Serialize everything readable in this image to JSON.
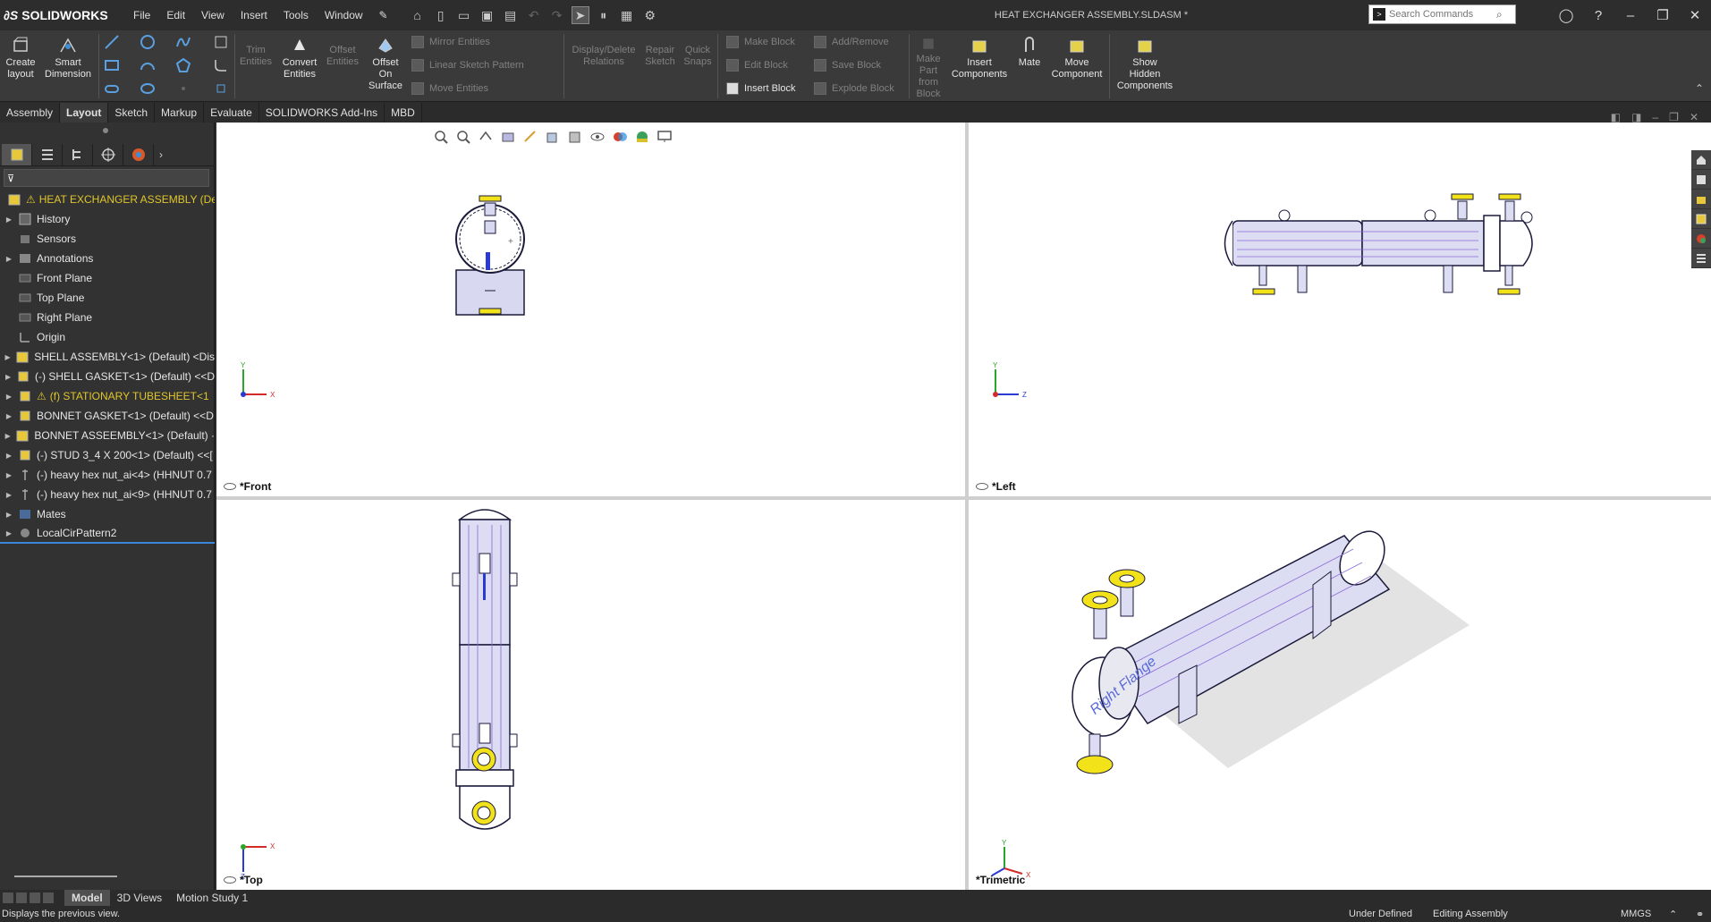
{
  "app": {
    "name": "SOLIDWORKS",
    "brand_color": "#da1f26"
  },
  "menu": [
    "File",
    "Edit",
    "View",
    "Insert",
    "Tools",
    "Window"
  ],
  "document_title": "HEAT EXCHANGER ASSEMBLY.SLDASM *",
  "search": {
    "placeholder": "Search Commands"
  },
  "ribbon": {
    "create_layout": "Create\nlayout",
    "smart_dimension": "Smart\nDimension",
    "trim_entities": "Trim\nEntities",
    "convert_entities": "Convert\nEntities",
    "offset_entities": "Offset\nEntities",
    "offset_on_surface": "Offset\nOn\nSurface",
    "mirror_entities": "Mirror Entities",
    "linear_sketch_pattern": "Linear Sketch Pattern",
    "move_entities": "Move Entities",
    "display_delete_relations": "Display/Delete\nRelations",
    "repair_sketch": "Repair\nSketch",
    "quick_snaps": "Quick\nSnaps",
    "make_block": "Make Block",
    "edit_block": "Edit Block",
    "insert_block": "Insert Block",
    "add_remove": "Add/Remove",
    "save_block": "Save Block",
    "explode_block": "Explode Block",
    "make_part_from_block": "Make\nPart\nfrom\nBlock",
    "insert_components": "Insert\nComponents",
    "mate": "Mate",
    "move_component": "Move\nComponent",
    "show_hidden_components": "Show\nHidden\nComponents"
  },
  "command_tabs": [
    "Assembly",
    "Layout",
    "Sketch",
    "Markup",
    "Evaluate",
    "SOLIDWORKS Add-Ins",
    "MBD"
  ],
  "active_tab": "Layout",
  "tree": [
    {
      "label": "HEAT EXCHANGER ASSEMBLY (Defa",
      "expand": "",
      "warn": true,
      "icon": "assembly-icon"
    },
    {
      "label": "History",
      "expand": "▶",
      "icon": "history-icon"
    },
    {
      "label": "Sensors",
      "expand": "",
      "icon": "sensor-icon"
    },
    {
      "label": "Annotations",
      "expand": "▶",
      "icon": "annotation-icon"
    },
    {
      "label": "Front Plane",
      "expand": "",
      "icon": "plane-icon"
    },
    {
      "label": "Top Plane",
      "expand": "",
      "icon": "plane-icon"
    },
    {
      "label": "Right Plane",
      "expand": "",
      "icon": "plane-icon"
    },
    {
      "label": "Origin",
      "expand": "",
      "icon": "origin-icon"
    },
    {
      "label": "SHELL ASSEMBLY<1> (Default) <Dis",
      "expand": "▶",
      "icon": "assembly-icon"
    },
    {
      "label": "(-) SHELL GASKET<1> (Default) <<D",
      "expand": "▶",
      "icon": "part-icon"
    },
    {
      "label": "(f) STATIONARY TUBESHEET<1",
      "expand": "▶",
      "warn": true,
      "icon": "part-icon"
    },
    {
      "label": "BONNET GASKET<1> (Default) <<D",
      "expand": "▶",
      "icon": "part-icon"
    },
    {
      "label": "BONNET ASSEEMBLY<1> (Default) ·",
      "expand": "▶",
      "icon": "assembly-icon"
    },
    {
      "label": "(-) STUD 3_4 X 200<1> (Default) <<[",
      "expand": "▶",
      "icon": "part-icon"
    },
    {
      "label": "(-) heavy hex nut_ai<4> (HHNUT 0.7",
      "expand": "▶",
      "icon": "toolbox-icon"
    },
    {
      "label": "(-) heavy hex nut_ai<9> (HHNUT 0.7",
      "expand": "▶",
      "icon": "toolbox-icon"
    },
    {
      "label": "Mates",
      "expand": "▶",
      "icon": "mates-icon"
    },
    {
      "label": "LocalCirPattern2",
      "expand": "▶",
      "icon": "pattern-icon"
    }
  ],
  "viewports": {
    "front": "*Front",
    "left": "*Left",
    "top": "*Top",
    "trimetric": "*Trimetric"
  },
  "bottom_tabs": [
    "Model",
    "3D Views",
    "Motion Study 1"
  ],
  "status": {
    "message": "Displays the previous view.",
    "sketch_state": "Under Defined",
    "mode": "Editing Assembly",
    "units": "MMGS"
  },
  "colors": {
    "flange": "#f2e21a",
    "shell": "#d8d8f0",
    "outline": "#1a1a3a",
    "axis_x": "#d42a2a",
    "axis_y": "#2aa62a",
    "axis_z": "#2a3ad4"
  }
}
